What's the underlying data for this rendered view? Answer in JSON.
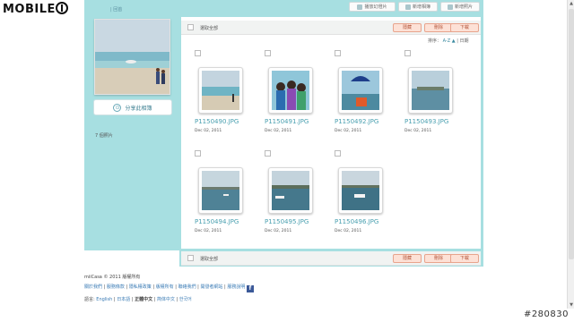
{
  "watermark": {
    "logo": "MOBILE01",
    "id": "#280830"
  },
  "breadcrumb": "| 回首",
  "toolbar": {
    "slideshow": "播放幻燈片",
    "new_album": "新增相簿",
    "add_photos": "新增照片"
  },
  "sidebar": {
    "share_label": "分享此相簿",
    "photo_count": "7 個照片"
  },
  "action_bar": {
    "select_all": "選取全部",
    "hide": "隱藏",
    "delete": "刪除",
    "download": "下載"
  },
  "sort": {
    "label": "排序：",
    "az": "A-Z ▲",
    "date": "日期"
  },
  "photos": [
    {
      "name": "P1150490.JPG",
      "date": "Dec 02, 2011"
    },
    {
      "name": "P1150491.JPG",
      "date": "Dec 02, 2011"
    },
    {
      "name": "P1150492.JPG",
      "date": "Dec 02, 2011"
    },
    {
      "name": "P1150493.JPG",
      "date": "Dec 02, 2011"
    },
    {
      "name": "P1150494.JPG",
      "date": "Dec 02, 2011"
    },
    {
      "name": "P1150495.JPG",
      "date": "Dec 02, 2011"
    },
    {
      "name": "P1150496.JPG",
      "date": "Dec 02, 2011"
    }
  ],
  "footer": {
    "copyright": "miiCasa © 2011",
    "rights": "版權所有",
    "links": [
      "關於我們",
      "服務條款",
      "隱私權政策",
      "版權所有",
      "聯絡我們",
      "開發者網站",
      "服務說明"
    ],
    "lang_label": "語言:",
    "languages": [
      "English",
      "日本語",
      "正體中文",
      "简体中文",
      "한국어"
    ]
  },
  "colors": {
    "accent": "#a7dfe1",
    "action": "#fde1d6",
    "link": "#4aa0b0"
  }
}
